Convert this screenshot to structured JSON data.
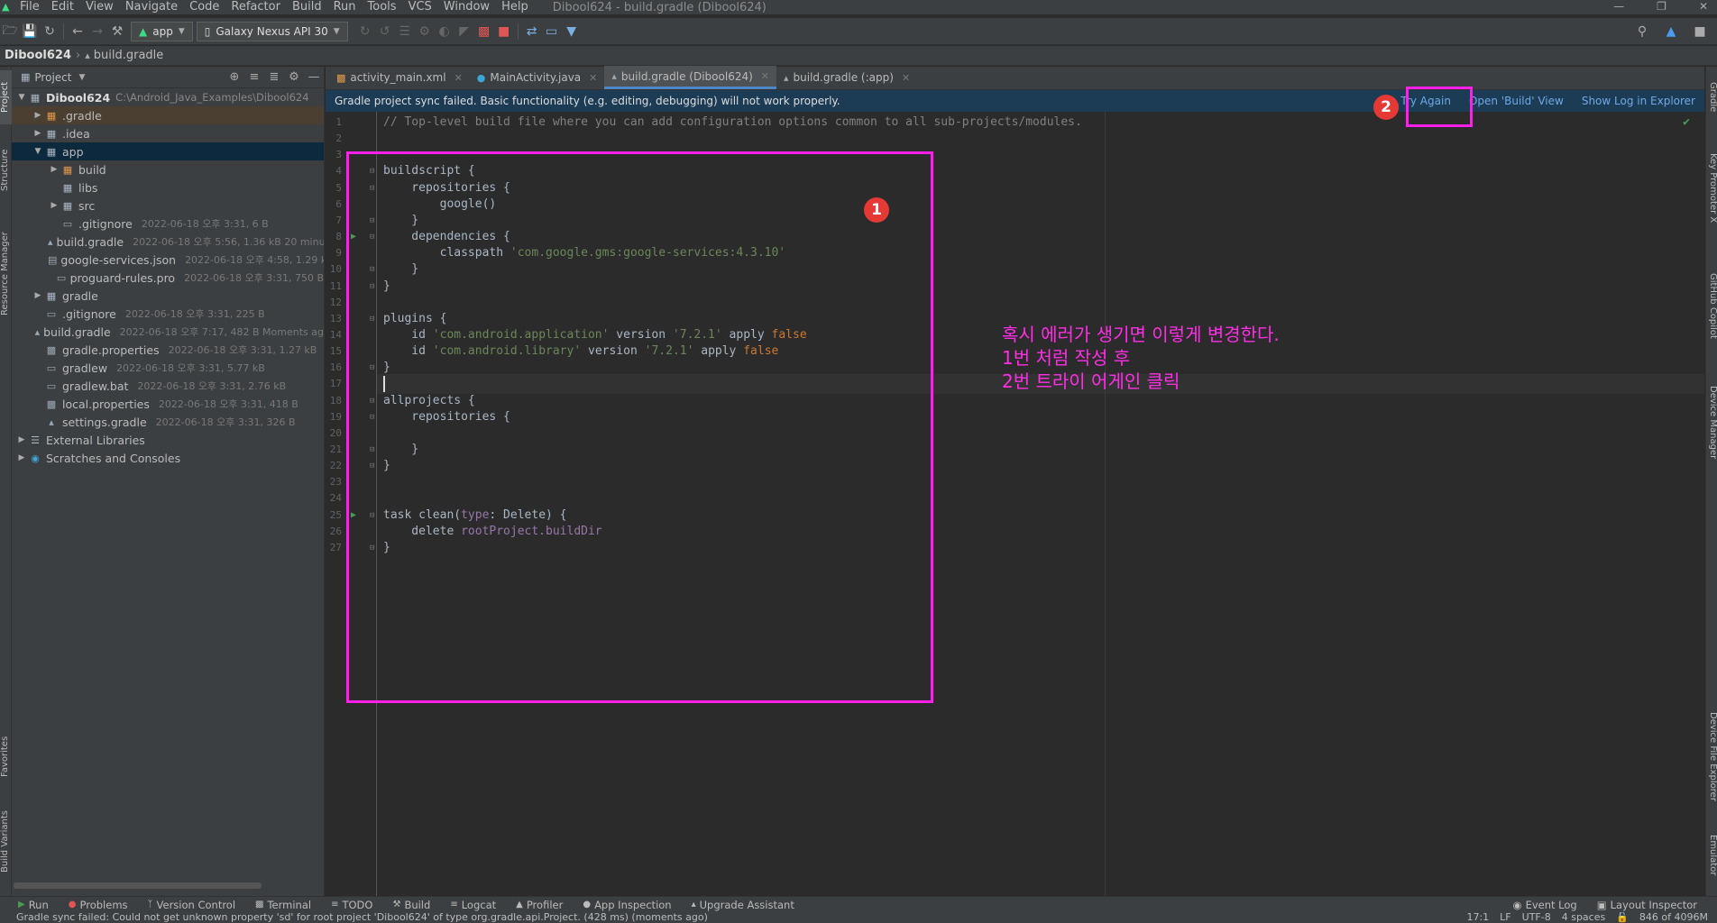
{
  "menu": {
    "items": [
      "File",
      "Edit",
      "View",
      "Navigate",
      "Code",
      "Refactor",
      "Build",
      "Run",
      "Tools",
      "VCS",
      "Window",
      "Help"
    ],
    "window_title": "Dibool624 - build.gradle (Dibool624)"
  },
  "toolbar": {
    "run_config": "app",
    "device": "Galaxy Nexus API 30"
  },
  "breadcrumb": {
    "project": "Dibool624",
    "file": "build.gradle"
  },
  "left_tool_tabs": [
    "Project",
    "Structure",
    "Resource Manager",
    "Favorites",
    "Build Variants"
  ],
  "right_tool_tabs": [
    "Gradle",
    "Key Promoter X",
    "GitHub Copilot",
    "Device Manager",
    "Device File Explorer",
    "Emulator"
  ],
  "project_panel": {
    "title": "Project",
    "tree": [
      {
        "name": "Dibool624",
        "path": "C:\\Android_Java_Examples\\Dibool624",
        "icon": "folder",
        "depth": 0,
        "expanded": true,
        "bold": true
      },
      {
        "name": ".gradle",
        "icon": "folder-orange",
        "depth": 1,
        "expanded": false,
        "highlight": true
      },
      {
        "name": ".idea",
        "icon": "folder",
        "depth": 1,
        "expanded": false
      },
      {
        "name": "app",
        "icon": "folder",
        "depth": 1,
        "expanded": true,
        "selected": true
      },
      {
        "name": "build",
        "icon": "folder-orange",
        "depth": 2,
        "expanded": false
      },
      {
        "name": "libs",
        "icon": "folder",
        "depth": 2
      },
      {
        "name": "src",
        "icon": "folder",
        "depth": 2,
        "expanded": false
      },
      {
        "name": ".gitignore",
        "meta": "2022-06-18 오후 3:31, 6 B",
        "icon": "file",
        "depth": 2
      },
      {
        "name": "build.gradle",
        "meta": "2022-06-18 오후 5:56, 1.36 kB 20 minu",
        "icon": "gradle",
        "depth": 2
      },
      {
        "name": "google-services.json",
        "meta": "2022-06-18 오후 4:58, 1.29 kB",
        "icon": "json",
        "depth": 2
      },
      {
        "name": "proguard-rules.pro",
        "meta": "2022-06-18 오후 3:31, 750 B",
        "icon": "file",
        "depth": 2
      },
      {
        "name": "gradle",
        "icon": "folder",
        "depth": 1,
        "expanded": false
      },
      {
        "name": ".gitignore",
        "meta": "2022-06-18 오후 3:31, 225 B",
        "icon": "file",
        "depth": 1
      },
      {
        "name": "build.gradle",
        "meta": "2022-06-18 오후 7:17, 482 B Moments ag",
        "icon": "gradle",
        "depth": 1
      },
      {
        "name": "gradle.properties",
        "meta": "2022-06-18 오후 3:31, 1.27 kB",
        "icon": "props",
        "depth": 1
      },
      {
        "name": "gradlew",
        "meta": "2022-06-18 오후 3:31, 5.77 kB",
        "icon": "file",
        "depth": 1
      },
      {
        "name": "gradlew.bat",
        "meta": "2022-06-18 오후 3:31, 2.76 kB",
        "icon": "file",
        "depth": 1
      },
      {
        "name": "local.properties",
        "meta": "2022-06-18 오후 3:31, 418 B",
        "icon": "props",
        "depth": 1
      },
      {
        "name": "settings.gradle",
        "meta": "2022-06-18 오후 3:31, 326 B",
        "icon": "gradle",
        "depth": 1
      },
      {
        "name": "External Libraries",
        "icon": "libs",
        "depth": 0,
        "expanded": false
      },
      {
        "name": "Scratches and Consoles",
        "icon": "scratch",
        "depth": 0,
        "expanded": false
      }
    ]
  },
  "editor_tabs": [
    {
      "label": "activity_main.xml",
      "icon": "xml",
      "active": false
    },
    {
      "label": "MainActivity.java",
      "icon": "java",
      "active": false
    },
    {
      "label": "build.gradle (Dibool624)",
      "icon": "gradle",
      "active": true
    },
    {
      "label": "build.gradle (:app)",
      "icon": "gradle",
      "active": false
    }
  ],
  "banner": {
    "message": "Gradle project sync failed. Basic functionality (e.g. editing, debugging) will not work properly.",
    "try_again": "Try Again",
    "open_build": "Open 'Build' View",
    "show_log": "Show Log in Explorer"
  },
  "code_lines": [
    [
      {
        "t": "// Top-level build file where you can add configuration options common to all sub-projects/modules.",
        "c": "cm"
      }
    ],
    [],
    [],
    [
      {
        "t": "buildscript {"
      }
    ],
    [
      {
        "t": "    repositories {"
      }
    ],
    [
      {
        "t": "        google()"
      }
    ],
    [
      {
        "t": "    }"
      }
    ],
    [
      {
        "t": "    dependencies {"
      }
    ],
    [
      {
        "t": "        classpath "
      },
      {
        "t": "'com.google.gms:google-services:4.3.10'",
        "c": "str"
      }
    ],
    [
      {
        "t": "    }"
      }
    ],
    [
      {
        "t": "}"
      }
    ],
    [],
    [
      {
        "t": "plugins {"
      }
    ],
    [
      {
        "t": "    id "
      },
      {
        "t": "'com.android.application'",
        "c": "str"
      },
      {
        "t": " version "
      },
      {
        "t": "'7.2.1'",
        "c": "str"
      },
      {
        "t": " apply "
      },
      {
        "t": "false",
        "c": "kw"
      }
    ],
    [
      {
        "t": "    id "
      },
      {
        "t": "'com.android.library'",
        "c": "str"
      },
      {
        "t": " version "
      },
      {
        "t": "'7.2.1'",
        "c": "str"
      },
      {
        "t": " apply "
      },
      {
        "t": "false",
        "c": "kw"
      }
    ],
    [
      {
        "t": "}"
      }
    ],
    [],
    [
      {
        "t": "allprojects {"
      }
    ],
    [
      {
        "t": "    repositories {"
      }
    ],
    [],
    [
      {
        "t": "    }"
      }
    ],
    [
      {
        "t": "}"
      }
    ],
    [],
    [],
    [
      {
        "t": "task clean("
      },
      {
        "t": "type",
        "c": "pur"
      },
      {
        "t": ": Delete) {"
      }
    ],
    [
      {
        "t": "    delete "
      },
      {
        "t": "rootProject.buildDir",
        "c": "pur"
      }
    ],
    [
      {
        "t": "}"
      }
    ]
  ],
  "run_marker_lines": [
    8,
    25
  ],
  "fold_lines": [
    4,
    5,
    7,
    8,
    10,
    11,
    13,
    16,
    18,
    19,
    21,
    22,
    25,
    27
  ],
  "current_line": 17,
  "annotations": {
    "marker_1": "1",
    "marker_2": "2",
    "note_lines": [
      "혹시 에러가 생기면 이렇게 변경한다.",
      "1번 처럼 작성 후",
      "2번 트라이 어게인 클릭"
    ],
    "color": "#ff1eea"
  },
  "bottom_tabs": [
    "Run",
    "Problems",
    "Version Control",
    "Terminal",
    "TODO",
    "Build",
    "Logcat",
    "Profiler",
    "App Inspection",
    "Upgrade Assistant"
  ],
  "bottom_right_tabs": [
    "Event Log",
    "Layout Inspector"
  ],
  "status": {
    "message": "Gradle sync failed: Could not get unknown property 'sd' for root project 'Dibool624' of type org.gradle.api.Project. (428 ms) (moments ago)",
    "position": "17:1",
    "line_sep": "LF",
    "encoding": "UTF-8",
    "indent": "4 spaces",
    "memory": "846 of 4096M"
  }
}
